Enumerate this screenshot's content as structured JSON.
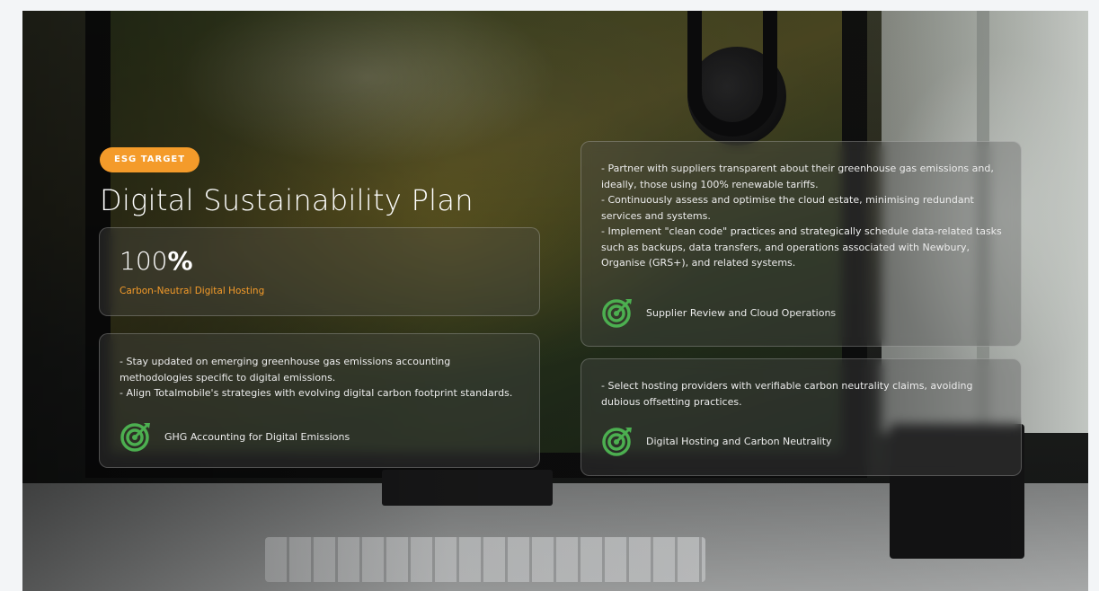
{
  "hero": {
    "badge": "ESG TARGET",
    "title": "Digital Sustainability Plan",
    "stat": {
      "value_number": "100",
      "value_unit": "%",
      "label": "Carbon-Neutral Digital Hosting"
    },
    "cards": [
      {
        "lines": [
          "- Stay updated on emerging greenhouse gas emissions accounting methodologies specific to digital emissions.",
          "- Align Totalmobile's strategies with evolving digital carbon footprint standards."
        ],
        "label": "GHG Accounting for Digital Emissions",
        "icon": "target-icon"
      },
      {
        "lines": [
          "- Partner with suppliers transparent about their greenhouse gas emissions and, ideally, those using 100% renewable tariffs.",
          "- Continuously assess and optimise the cloud estate, minimising redundant services and systems.",
          "- Implement \"clean code\" practices and strategically schedule data-related tasks such as backups, data transfers, and operations associated with Newbury, Organise (GRS+), and related systems."
        ],
        "label": "Supplier Review and Cloud Operations",
        "icon": "target-icon"
      },
      {
        "lines": [
          "- Select hosting providers with verifiable carbon neutrality claims, avoiding dubious offsetting practices."
        ],
        "label": "Digital Hosting and Carbon Neutrality",
        "icon": "target-icon"
      }
    ]
  },
  "colors": {
    "accent": "#f49b2a",
    "icon_green": "#4caf50",
    "card_text": "#ececec"
  }
}
